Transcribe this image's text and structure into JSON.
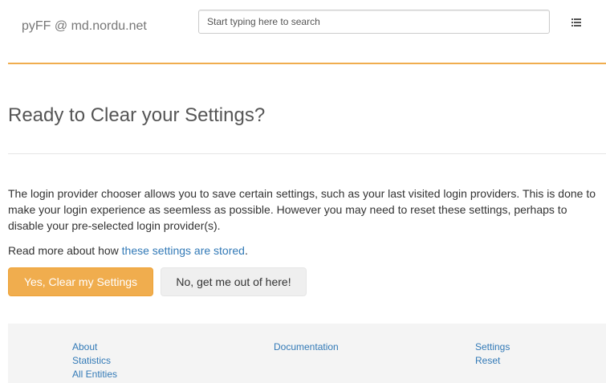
{
  "navbar": {
    "brand": "pyFF @ md.nordu.net",
    "search_placeholder": "Start typing here to search",
    "menu_icon": "list-icon",
    "accent_color": "#f0ad4e"
  },
  "main": {
    "title": "Ready to Clear your Settings?",
    "description": "The login provider chooser allows you to save certain settings, such as your last visited login providers. This is done to make your login experience as seemless as possible. However you may need to reset these settings, perhaps to disable your pre-selected login provider(s).",
    "read_more_prefix": "Read more about how ",
    "read_more_link": "these settings are stored",
    "read_more_suffix": ".",
    "confirm_button": "Yes, Clear my Settings",
    "cancel_button": "No, get me out of here!"
  },
  "footer": {
    "col1": [
      "About",
      "Statistics",
      "All Entities"
    ],
    "col2": [
      "Documentation"
    ],
    "col3": [
      "Settings",
      "Reset"
    ]
  }
}
